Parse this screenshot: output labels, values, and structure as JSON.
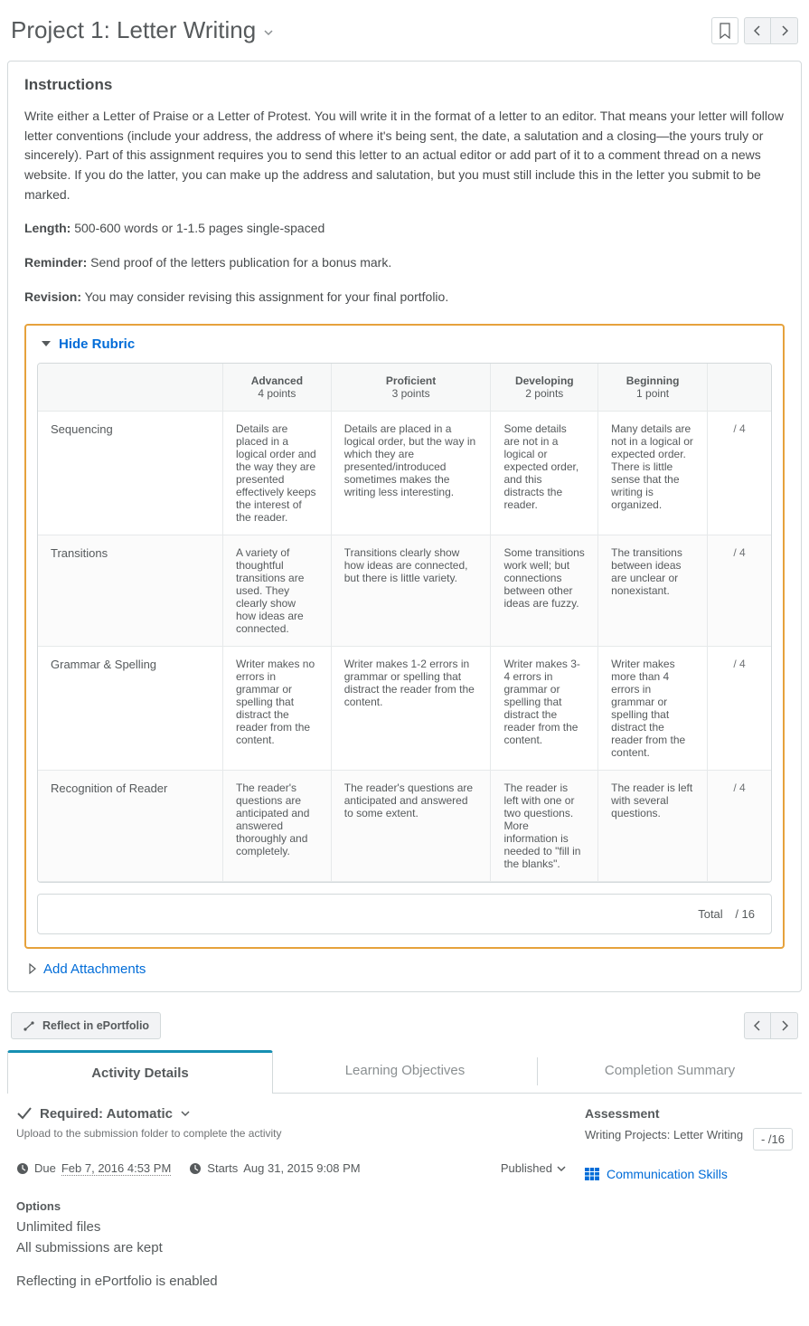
{
  "header": {
    "title": "Project 1: Letter Writing"
  },
  "instructions": {
    "heading": "Instructions",
    "body": "Write either a Letter of Praise or a Letter of Protest. You will write it in the format of a letter to an editor. That means your letter will follow letter conventions (include your address, the address of where it's being sent, the date, a salutation and a closing—the yours truly or sincerely). Part of this assignment requires you to send this letter to an actual editor or add part of it to a comment thread on a news website. If you do the latter, you can make up the address and salutation, but you must still include this in the letter you submit to be marked.",
    "length_label": "Length:",
    "length_text": " 500-600 words or 1-1.5 pages single-spaced",
    "reminder_label": "Reminder:",
    "reminder_text": " Send proof of the letters publication for a bonus mark.",
    "revision_label": "Revision:",
    "revision_text": " You may consider revising this assignment for your final portfolio."
  },
  "rubric": {
    "toggle_label": "Hide Rubric",
    "levels": [
      {
        "name": "Advanced",
        "points": "4 points"
      },
      {
        "name": "Proficient",
        "points": "3 points"
      },
      {
        "name": "Developing",
        "points": "2 points"
      },
      {
        "name": "Beginning",
        "points": "1 point"
      }
    ],
    "rows": [
      {
        "criterion": "Sequencing",
        "cells": [
          "Details are placed in a logical order and  the way they are presented effectively keeps the interest of the reader.",
          "Details are placed in a logical order, but the way in which they are presented/introduced sometimes makes the writing less interesting.",
          "Some details are not in a logical or expected order, and this distracts the reader.",
          "Many details are not in a logical or expected order. There is little sense that the writing is organized."
        ],
        "score": "/  4"
      },
      {
        "criterion": "Transitions",
        "cells": [
          "A variety of thoughtful transitions are used. They clearly show how ideas are connected.",
          "Transitions clearly show how ideas are connected, but there is little variety.",
          "Some transitions  work well; but connections between other ideas are fuzzy.",
          "The transitions between ideas are unclear or nonexistant."
        ],
        "score": "/  4"
      },
      {
        "criterion": "Grammar & Spelling",
        "cells": [
          "Writer makes no errors in grammar or spelling that distract the reader from the content.",
          "Writer makes 1-2 errors in grammar or spelling that distract the reader from the content.",
          "Writer makes 3-4 errors in grammar or spelling that distract the reader from the content.",
          "Writer makes more than 4 errors in grammar or spelling that distract the reader from the content."
        ],
        "score": "/  4"
      },
      {
        "criterion": "Recognition of Reader",
        "cells": [
          "The reader's questions are anticipated and answered thoroughly and completely.",
          "The reader's questions are anticipated and answered to some extent.",
          "The reader is left with one or two questions. More information is needed to \"fill in the blanks\".",
          "The reader is left with several questions."
        ],
        "score": "/  4"
      }
    ],
    "total_label": "Total",
    "total_value": "/  16"
  },
  "attachments": {
    "label": "Add Attachments"
  },
  "reflect_button": "Reflect in ePortfolio",
  "tabs": {
    "activity": "Activity Details",
    "objectives": "Learning Objectives",
    "completion": "Completion Summary"
  },
  "details": {
    "required_label": "Required: Automatic",
    "required_sub": "Upload to the submission folder to complete the activity",
    "due_label": "Due ",
    "due_value": "Feb 7, 2016 4:53 PM",
    "start_label": "Starts ",
    "start_value": "Aug 31, 2015 9:08 PM",
    "published_label": "Published",
    "options_title": "Options",
    "options": [
      "Unlimited files",
      "All submissions are kept",
      "Reflecting in ePortfolio is enabled"
    ]
  },
  "assessment": {
    "title": "Assessment",
    "item_label": "Writing Projects: Letter Writing",
    "score": "- /16",
    "link_text": "Communication Skills"
  }
}
